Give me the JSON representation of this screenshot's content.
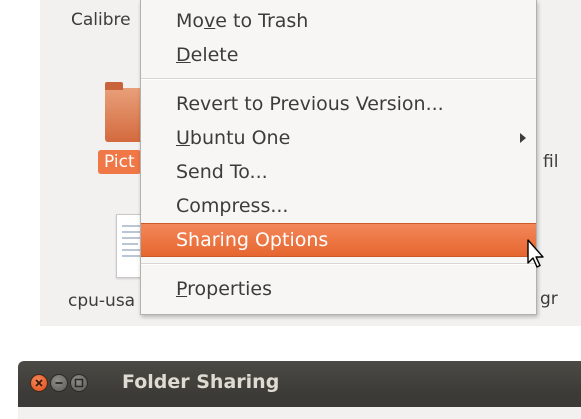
{
  "desktop": {
    "file_labels": {
      "calibre": "Calibre",
      "pictures": "Pict",
      "cpu_usage": "cpu-usa",
      "right_top": "fil",
      "right_bottom": "gr"
    }
  },
  "context_menu": {
    "items": [
      {
        "label_pre": "Mo",
        "accel": "v",
        "label_post": "e to Trash"
      },
      {
        "label_pre": "",
        "accel": "D",
        "label_post": "elete"
      },
      {
        "label": "Revert to Previous Version..."
      },
      {
        "label_pre": "",
        "accel": "U",
        "label_post": "buntu One",
        "has_submenu": true
      },
      {
        "label": "Send To..."
      },
      {
        "label": "Compress..."
      },
      {
        "label": "Sharing Options",
        "highlighted": true
      },
      {
        "label_pre": "",
        "accel": "P",
        "label_post": "roperties"
      }
    ],
    "highlight_color": "#e96b36"
  },
  "dialog": {
    "title": "Folder Sharing",
    "controls": [
      "close-icon",
      "minimize-icon",
      "maximize-icon"
    ],
    "close_color": "#e9541e"
  }
}
